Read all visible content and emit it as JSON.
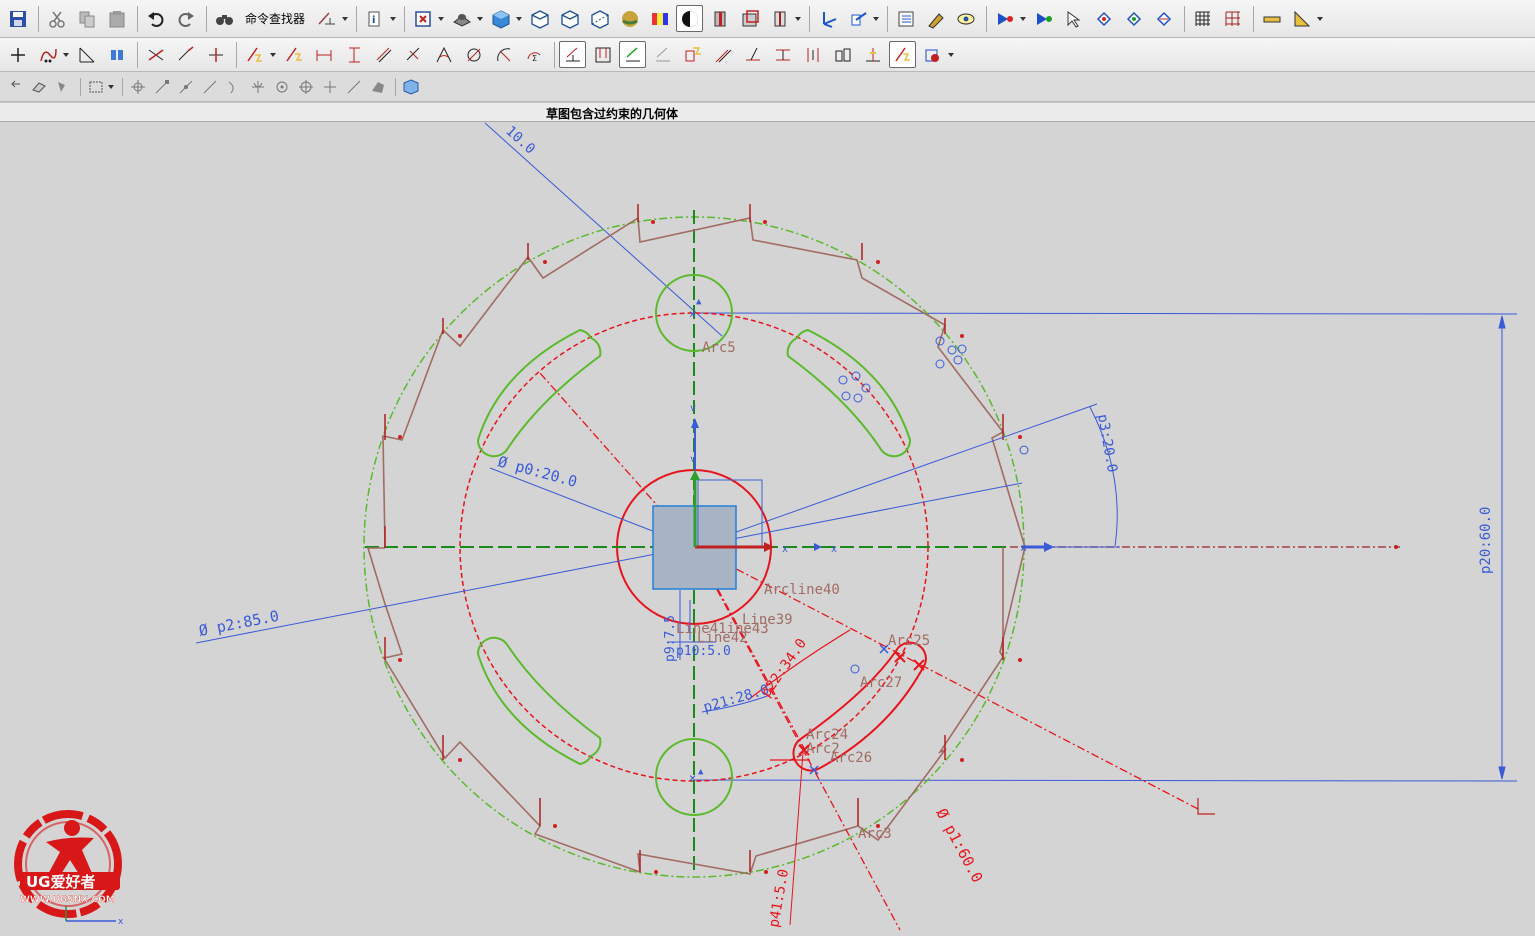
{
  "toolbar": {
    "command_finder_label": "命令查找器"
  },
  "view": {
    "title": "草图包含过约束的几何体"
  },
  "sketch": {
    "dimensions": {
      "p0": "Ø p0:20.0",
      "p1": "Ø p1:60.0",
      "p2": "Ø p2:85.0",
      "p3": "p3:20.0",
      "p20": "p20:60.0",
      "p21": "p21:28.0",
      "p22": "p22:34.0",
      "p41": "p41:5.0",
      "top": "10.0",
      "small_a": "p9:7.5",
      "small_b": "p10:5.0"
    },
    "labels": {
      "arc5": "Arc5",
      "arc3": "Arc3",
      "arc25": "Arc25",
      "arc27": "Arc27",
      "arc24": "Arc24",
      "arc2": "Arc2",
      "arc26": "Arc26",
      "line40": "Arcline40",
      "line39": "Line39",
      "line41": "Line41ine43",
      "line42": "Line42"
    },
    "colors": {
      "construction_green": "#5aba2c",
      "red": "#e8141c",
      "blue_dim": "#2d5fd8",
      "brown": "#a06c64",
      "dark_green_axis": "#1a8a1a"
    }
  },
  "logo": {
    "text": "UG爱好者",
    "url": "WWW.UGSNX.COM"
  }
}
